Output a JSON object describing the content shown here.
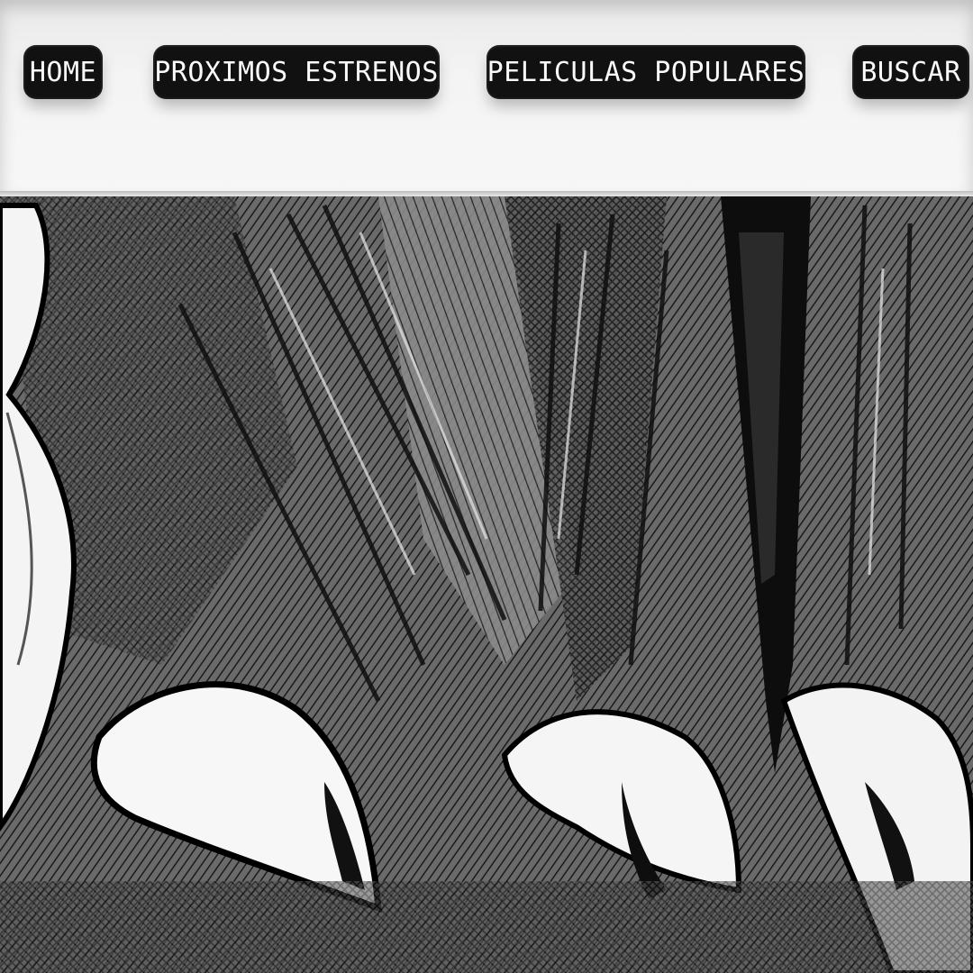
{
  "nav": {
    "items": [
      {
        "label": "HOME"
      },
      {
        "label": "PROXIMOS ESTRENOS"
      },
      {
        "label": "PELICULAS POPULARES"
      },
      {
        "label": "BUSCAR"
      }
    ]
  },
  "hero": {
    "image": "manga-style-illustration"
  }
}
